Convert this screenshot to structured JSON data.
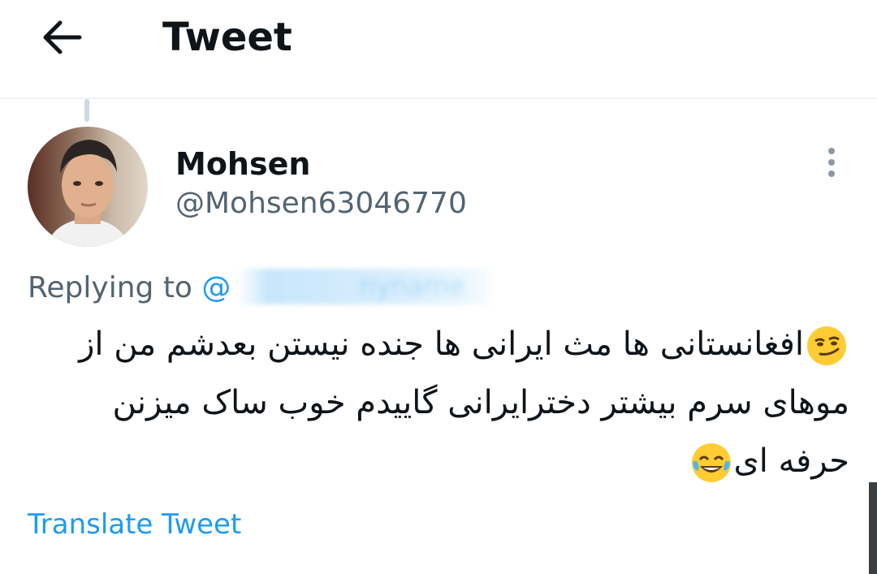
{
  "header": {
    "title": "Tweet",
    "back_icon": "arrow-left-icon"
  },
  "author": {
    "display_name": "Mohsen",
    "handle": "@Mohsen63046770",
    "avatar_icon": "avatar-photo"
  },
  "reply": {
    "prefix": "Replying to",
    "handle_visible": "@",
    "handle_redacted_fragment": "nyname"
  },
  "tweet": {
    "line1": "افغانستانی ها مث ایرانی ها جنده نیستن بعدشم من از",
    "line2": "موهای سرم بیشتر دخترایرانی گاییدم خوب ساک میزنن",
    "line3": "حرفه ای",
    "emoji1": "smirking-face-emoji",
    "emoji2": "face-with-tears-of-joy-emoji"
  },
  "translate_label": "Translate Tweet",
  "colors": {
    "accent": "#1d9bf0",
    "secondary_text": "#536471",
    "primary_text": "#0f1419",
    "divider": "#eff3f4"
  }
}
